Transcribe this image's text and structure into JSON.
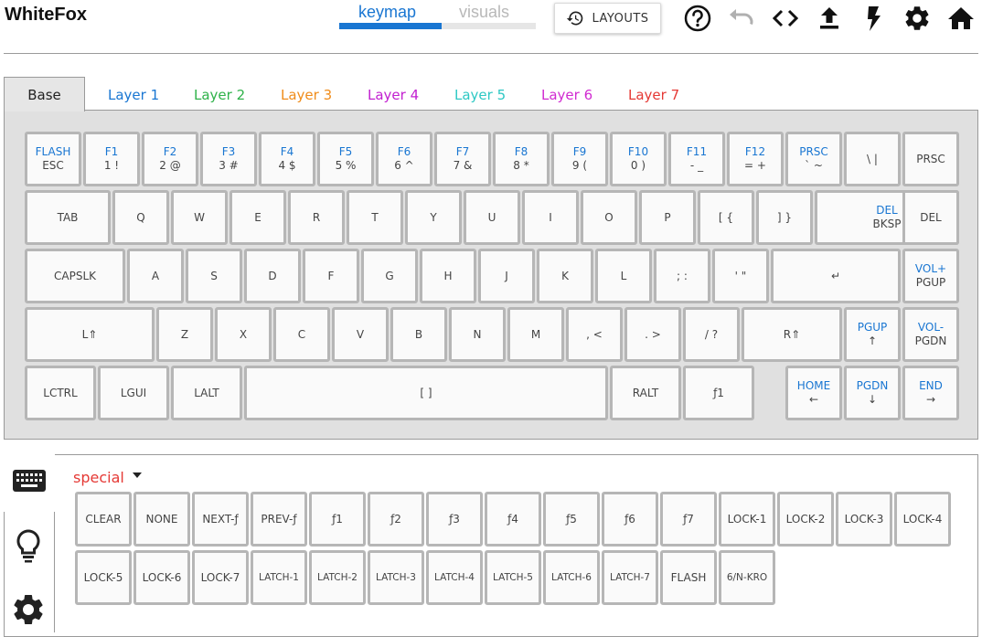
{
  "app": {
    "title": "WhiteFox"
  },
  "view_tabs": {
    "keymap": "keymap",
    "visuals": "visuals",
    "keymap_active_fraction": 0.52
  },
  "toolbar": {
    "layouts_label": "LAYOUTS",
    "icons": [
      "help-icon",
      "undo-icon",
      "code-icon",
      "upload-icon",
      "flash-icon",
      "settings-icon",
      "home-icon"
    ]
  },
  "layers": {
    "active": "Base",
    "tabs": [
      {
        "label": "Base",
        "color": "#222222"
      },
      {
        "label": "Layer 1",
        "color": "#1976d2"
      },
      {
        "label": "Layer 2",
        "color": "#2fb24a"
      },
      {
        "label": "Layer 3",
        "color": "#f08c1a"
      },
      {
        "label": "Layer 4",
        "color": "#c21fd0"
      },
      {
        "label": "Layer 5",
        "color": "#2ec8c4"
      },
      {
        "label": "Layer 6",
        "color": "#d12bd1"
      },
      {
        "label": "Layer 7",
        "color": "#e53935"
      }
    ]
  },
  "keyboard": {
    "rows": [
      [
        {
          "top": "FLASH",
          "main": "ESC"
        },
        {
          "top": "F1",
          "main": "1 !"
        },
        {
          "top": "F2",
          "main": "2 @"
        },
        {
          "top": "F3",
          "main": "3 #"
        },
        {
          "top": "F4",
          "main": "4 $"
        },
        {
          "top": "F5",
          "main": "5 %"
        },
        {
          "top": "F6",
          "main": "6 ^"
        },
        {
          "top": "F7",
          "main": "7 &"
        },
        {
          "top": "F8",
          "main": "8 *"
        },
        {
          "top": "F9",
          "main": "9 ("
        },
        {
          "top": "F10",
          "main": "0 )"
        },
        {
          "top": "F11",
          "main": "- _"
        },
        {
          "top": "F12",
          "main": "= +"
        },
        {
          "top": "PRSC",
          "main": "` ~"
        },
        {
          "top": "",
          "main": "\\ |"
        },
        {
          "top": "",
          "main": "PRSC"
        }
      ],
      [
        {
          "top": "",
          "main": "TAB"
        },
        {
          "top": "",
          "main": "Q"
        },
        {
          "top": "",
          "main": "W"
        },
        {
          "top": "",
          "main": "E"
        },
        {
          "top": "",
          "main": "R"
        },
        {
          "top": "",
          "main": "T"
        },
        {
          "top": "",
          "main": "Y"
        },
        {
          "top": "",
          "main": "U"
        },
        {
          "top": "",
          "main": "I"
        },
        {
          "top": "",
          "main": "O"
        },
        {
          "top": "",
          "main": "P"
        },
        {
          "top": "",
          "main": "[ {"
        },
        {
          "top": "",
          "main": "] }"
        },
        {
          "top": "DEL",
          "main": "BKSP"
        },
        {
          "top": "",
          "main": "DEL"
        }
      ],
      [
        {
          "top": "",
          "main": "CAPSLK"
        },
        {
          "top": "",
          "main": "A"
        },
        {
          "top": "",
          "main": "S"
        },
        {
          "top": "",
          "main": "D"
        },
        {
          "top": "",
          "main": "F"
        },
        {
          "top": "",
          "main": "G"
        },
        {
          "top": "",
          "main": "H"
        },
        {
          "top": "",
          "main": "J"
        },
        {
          "top": "",
          "main": "K"
        },
        {
          "top": "",
          "main": "L"
        },
        {
          "top": "",
          "main": "; :"
        },
        {
          "top": "",
          "main": "' \""
        },
        {
          "top": "",
          "main": "↵"
        },
        {
          "top": "VOL+",
          "main": "PGUP"
        }
      ],
      [
        {
          "top": "",
          "main": "L⇑"
        },
        {
          "top": "",
          "main": "Z"
        },
        {
          "top": "",
          "main": "X"
        },
        {
          "top": "",
          "main": "C"
        },
        {
          "top": "",
          "main": "V"
        },
        {
          "top": "",
          "main": "B"
        },
        {
          "top": "",
          "main": "N"
        },
        {
          "top": "",
          "main": "M"
        },
        {
          "top": "",
          "main": ", <"
        },
        {
          "top": "",
          "main": ". >"
        },
        {
          "top": "",
          "main": "/ ?"
        },
        {
          "top": "",
          "main": "R⇑"
        },
        {
          "top": "PGUP",
          "main": "↑"
        },
        {
          "top": "VOL-",
          "main": "PGDN"
        }
      ],
      [
        {
          "top": "",
          "main": "LCTRL"
        },
        {
          "top": "",
          "main": "LGUI"
        },
        {
          "top": "",
          "main": "LALT"
        },
        {
          "top": "",
          "main": "[ ]"
        },
        {
          "top": "",
          "main": "RALT"
        },
        {
          "top": "",
          "main": "ƒ1"
        },
        {
          "top": "HOME",
          "main": "←"
        },
        {
          "top": "PGDN",
          "main": "↓"
        },
        {
          "top": "END",
          "main": "→"
        }
      ]
    ]
  },
  "selector": {
    "category": "special",
    "keys": [
      "CLEAR",
      "NONE",
      "NEXT-ƒ",
      "PREV-ƒ",
      "ƒ1",
      "ƒ2",
      "ƒ3",
      "ƒ4",
      "ƒ5",
      "ƒ6",
      "ƒ7",
      "LOCK-1",
      "LOCK-2",
      "LOCK-3",
      "LOCK-4",
      "LOCK-5",
      "LOCK-6",
      "LOCK-7",
      "LATCH-1",
      "LATCH-2",
      "LATCH-3",
      "LATCH-4",
      "LATCH-5",
      "LATCH-6",
      "LATCH-7",
      "FLASH",
      "6/N-KRO"
    ]
  },
  "side_tabs": [
    "keyboard-icon",
    "lightbulb-icon",
    "settings-icon"
  ]
}
